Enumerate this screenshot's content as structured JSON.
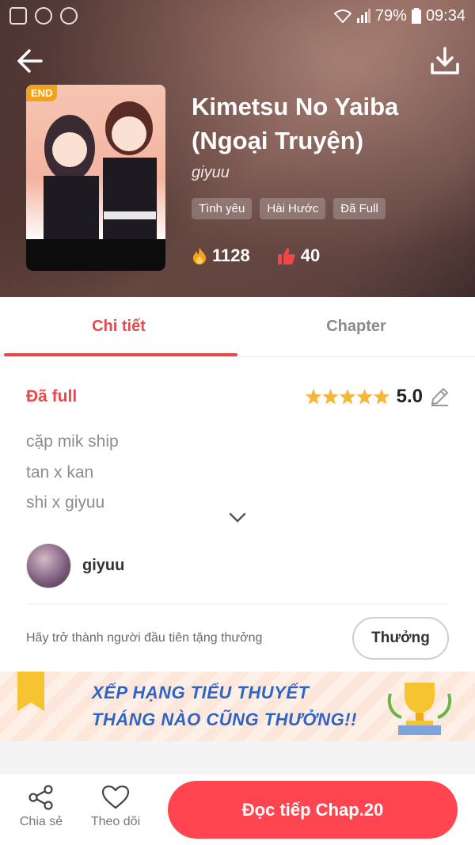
{
  "status_bar": {
    "battery": "79%",
    "time": "09:34",
    "left_icons": [
      "image-icon",
      "messenger-icon",
      "sync-icon"
    ],
    "right_icons": [
      "wifi-icon",
      "signal-icon",
      "battery-icon"
    ]
  },
  "header": {
    "back_icon": "arrow-left-icon",
    "download_icon": "download-icon",
    "badge": "END",
    "title": "Kimetsu No Yaiba (Ngoại Truyện)",
    "author": "giyuu",
    "tags": [
      "Tình yêu",
      "Hài Hước",
      "Đã Full"
    ],
    "views": "1128",
    "likes": "40"
  },
  "tabs": [
    {
      "label": "Chi tiết",
      "active": true
    },
    {
      "label": "Chapter",
      "active": false
    }
  ],
  "detail": {
    "status": "Đã full",
    "rating_stars": 5,
    "rating": "5.0",
    "description": [
      "cặp mik ship",
      "tan x kan",
      "shi x giyuu"
    ],
    "author_name": "giyuu",
    "reward_text": "Hãy trở thành người đầu tiên tặng thưởng",
    "reward_button": "Thưởng"
  },
  "banner": {
    "line1": "XẾP HẠNG TIỂU THUYẾT",
    "line2": "THÁNG NÀO CŨNG THƯỞNG!!"
  },
  "bottom_bar": {
    "share_label": "Chia sẻ",
    "follow_label": "Theo dõi",
    "read_button": "Đọc tiếp Chap.20"
  },
  "colors": {
    "accent": "#e5484d",
    "read_button": "#ff454f",
    "star": "#f5b63a",
    "banner_text": "#2f64c7"
  }
}
